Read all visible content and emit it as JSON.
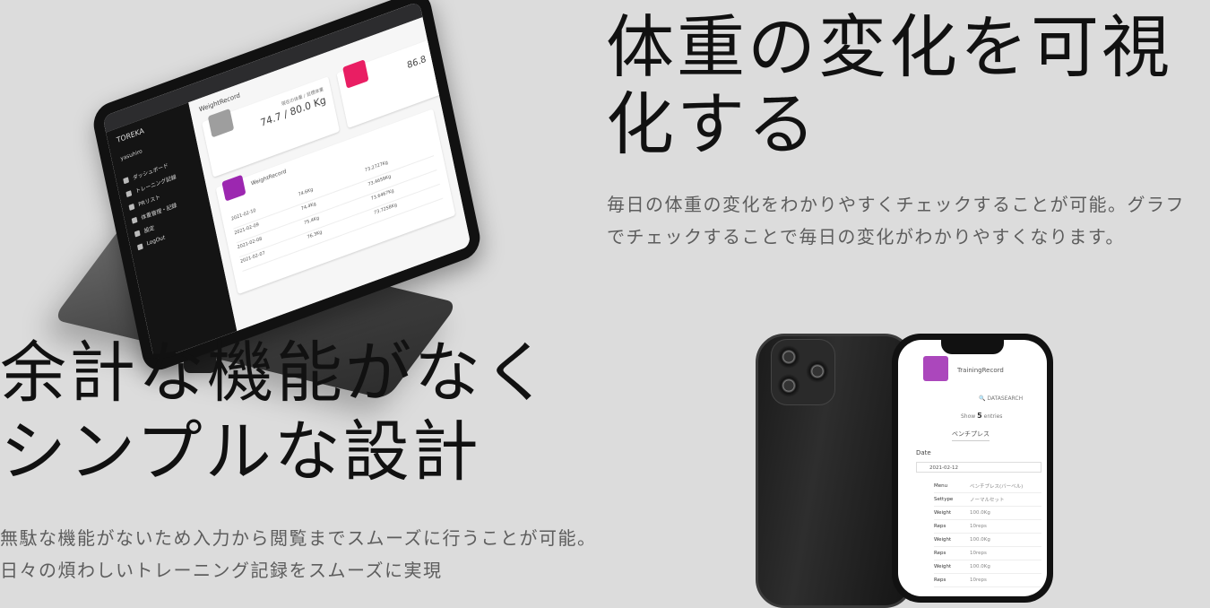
{
  "section1": {
    "title": "体重の変化を可視化する",
    "description": "毎日の体重の変化をわかりやすくチェックすることが可能。グラフでチェックすることで毎日の変化がわかりやすくなります。"
  },
  "section2": {
    "title": "余計な機能がなくシンプルな設計",
    "description": "無駄な機能がないため入力から閲覧までスムーズに行うことが可能。日々の煩わしいトレーニング記録をスムーズに実現"
  },
  "tablet": {
    "brand": "TOREKA",
    "user": "yasuhiro",
    "menu": [
      "ダッシュボード",
      "トレーニング記録",
      "PRリスト",
      "体重管理・記録",
      "設定",
      "LogOut"
    ],
    "app_title": "WeightRecord",
    "card1_label": "現在の体重 / 目標体重",
    "card1_value": "74.7 / 80.0 Kg",
    "card2_value": "86.8",
    "table_title": "WeightRecord",
    "rows": [
      [
        "2021-02-10",
        "74.6Kg",
        "73.2727Kg"
      ],
      [
        "2021-02-09",
        "74.4Kg",
        "73.4659Kg"
      ],
      [
        "2021-02-08",
        "75.4Kg",
        "73.6467Kg"
      ],
      [
        "2021-02-07",
        "76.3Kg",
        "73.7258Kg"
      ]
    ]
  },
  "phone": {
    "app_title": "TrainingRecord",
    "search": "DATASEARCH",
    "show_label": "Show",
    "show_value": "5",
    "entries_label": "entries",
    "menu_value": "ベンチプレス",
    "date_header": "Date",
    "date_value": "2021-02-12",
    "rows": [
      [
        "Menu",
        "ベンチプレス(バーベル)"
      ],
      [
        "Settype",
        "ノーマルセット"
      ],
      [
        "Weight",
        "100.0Kg"
      ],
      [
        "Reps",
        "10reps"
      ],
      [
        "Weight",
        "100.0Kg"
      ],
      [
        "Reps",
        "10reps"
      ],
      [
        "Weight",
        "100.0Kg"
      ],
      [
        "Reps",
        "10reps"
      ]
    ]
  }
}
